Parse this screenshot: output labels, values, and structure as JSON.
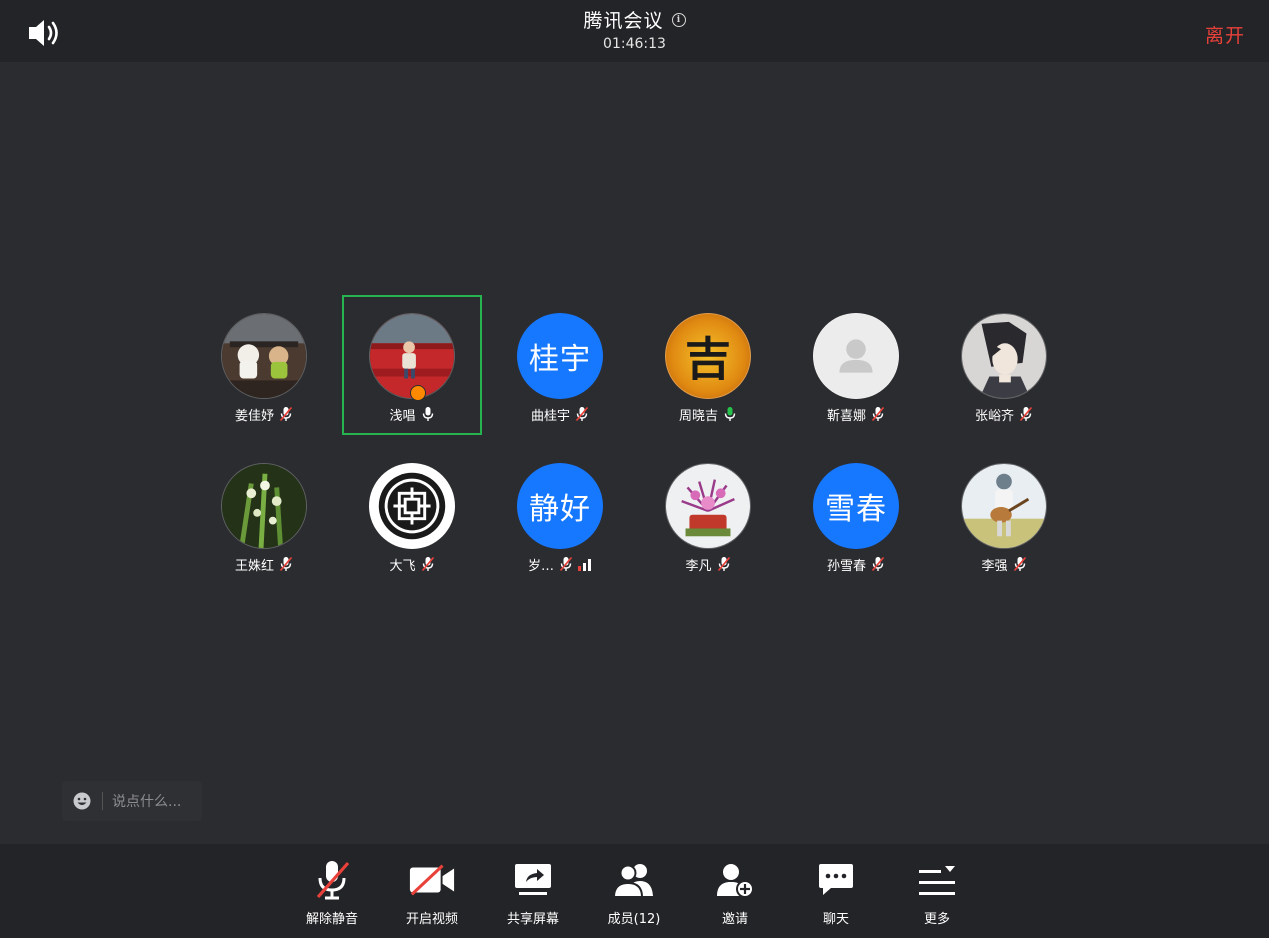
{
  "header": {
    "title": "腾讯会议",
    "info_icon": "i",
    "timer": "01:46:13",
    "leave_label": "离开"
  },
  "participants": [
    {
      "name": "姜佳妤",
      "avatar": "photo-dogs",
      "mic": "muted"
    },
    {
      "name": "浅唱",
      "avatar": "photo-red-bus",
      "mic": "on",
      "active_speaker": true,
      "host": true
    },
    {
      "name": "曲桂宇",
      "avatar_text": "桂宇",
      "mic": "muted"
    },
    {
      "name": "周晓吉",
      "avatar": "photo-ji-character",
      "avatar_text": "吉",
      "mic": "speaking"
    },
    {
      "name": "靳喜娜",
      "avatar": "default-person",
      "mic": "muted"
    },
    {
      "name": "张峪齐",
      "avatar": "photo-anime",
      "mic": "muted"
    },
    {
      "name": "王姝红",
      "avatar": "photo-plant",
      "mic": "muted"
    },
    {
      "name": "大飞",
      "avatar": "photo-chinese-pattern",
      "mic": "muted"
    },
    {
      "name": "岁…",
      "avatar_text": "静好",
      "mic": "muted",
      "signal": true
    },
    {
      "name": "李凡",
      "avatar": "photo-flowers",
      "mic": "muted"
    },
    {
      "name": "孙雪春",
      "avatar_text": "雪春",
      "mic": "muted"
    },
    {
      "name": "李强",
      "avatar": "photo-guitar",
      "mic": "muted"
    }
  ],
  "chat": {
    "placeholder": "说点什么..."
  },
  "toolbar": {
    "unmute_label": "解除静音",
    "video_label": "开启视频",
    "share_label": "共享屏幕",
    "members_label": "成员(12)",
    "invite_label": "邀请",
    "chat_label": "聊天",
    "more_label": "更多"
  },
  "colors": {
    "background": "#2b2c2f",
    "bar": "#232427",
    "leave": "#e8413a",
    "active_border": "#27b34f",
    "text_avatar": "#1677ff",
    "muted_slash": "#e8413a",
    "speaking_mic": "#27c24c"
  }
}
